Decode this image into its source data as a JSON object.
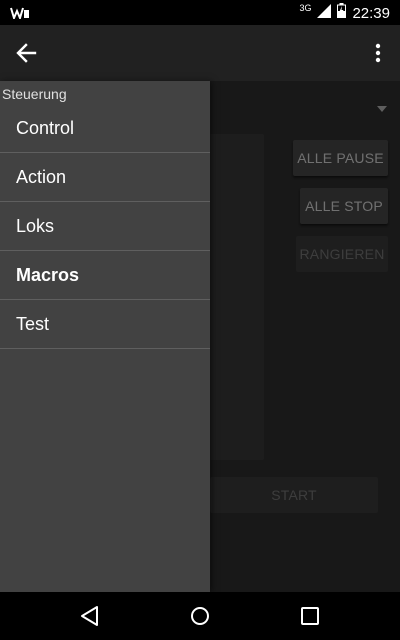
{
  "status_bar": {
    "network_type": "3G",
    "time": "22:39",
    "left_icon": "app-notification-icon",
    "signal_icon": "signal-icon",
    "battery_icon": "battery-charging-icon"
  },
  "app_bar": {
    "back_icon": "arrow-back-icon",
    "overflow_icon": "more-vert-icon"
  },
  "main": {
    "buttons": {
      "alle_pause": "ALLE PAUSE",
      "alle_stop": "ALLE STOP",
      "rangieren": "RANGIEREN",
      "start": "START"
    }
  },
  "drawer": {
    "header": "Steuerung",
    "items": [
      {
        "label": "Control"
      },
      {
        "label": "Action"
      },
      {
        "label": "Loks"
      },
      {
        "label": "Macros"
      },
      {
        "label": "Test"
      }
    ],
    "active_index": 3
  },
  "nav_bar": {
    "back_icon": "nav-back-icon",
    "home_icon": "nav-home-icon",
    "recents_icon": "nav-recents-icon"
  },
  "colors": {
    "app_bar": "#212121",
    "content_bg": "#303030",
    "drawer_bg": "#424242"
  }
}
